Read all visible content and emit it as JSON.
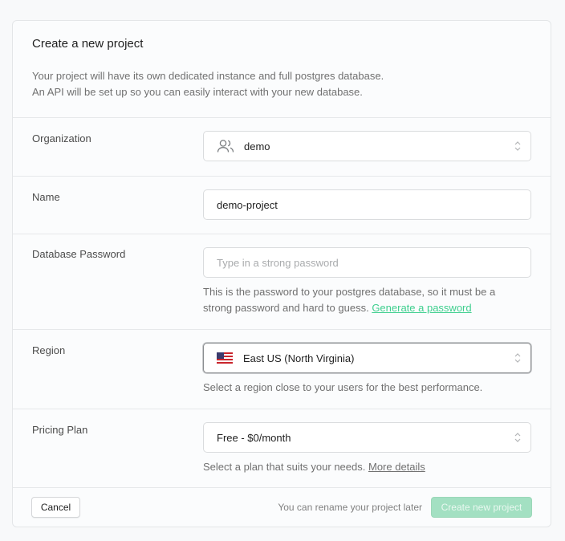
{
  "header": {
    "title": "Create a new project",
    "description_line1": "Your project will have its own dedicated instance and full postgres database.",
    "description_line2": "An API will be set up so you can easily interact with your new database."
  },
  "organization": {
    "label": "Organization",
    "value": "demo",
    "icon": "users-icon"
  },
  "name": {
    "label": "Name",
    "value": "demo-project"
  },
  "password": {
    "label": "Database Password",
    "placeholder": "Type in a strong password",
    "help_line1": "This is the password to your postgres database, so it must be a",
    "help_line2": "strong password and hard to guess.",
    "generate_link": "Generate a password"
  },
  "region": {
    "label": "Region",
    "value": "East US (North Virginia)",
    "flag": "us-flag-icon",
    "help": "Select a region close to your users for the best performance."
  },
  "pricing": {
    "label": "Pricing Plan",
    "value": "Free - $0/month",
    "help": "Select a plan that suits your needs.",
    "details_link": "More details"
  },
  "footer": {
    "cancel": "Cancel",
    "rename_note": "You can rename your project later",
    "create": "Create new project"
  },
  "colors": {
    "accent": "#3ecf8e",
    "create_button_disabled": "#a3e0c2"
  }
}
